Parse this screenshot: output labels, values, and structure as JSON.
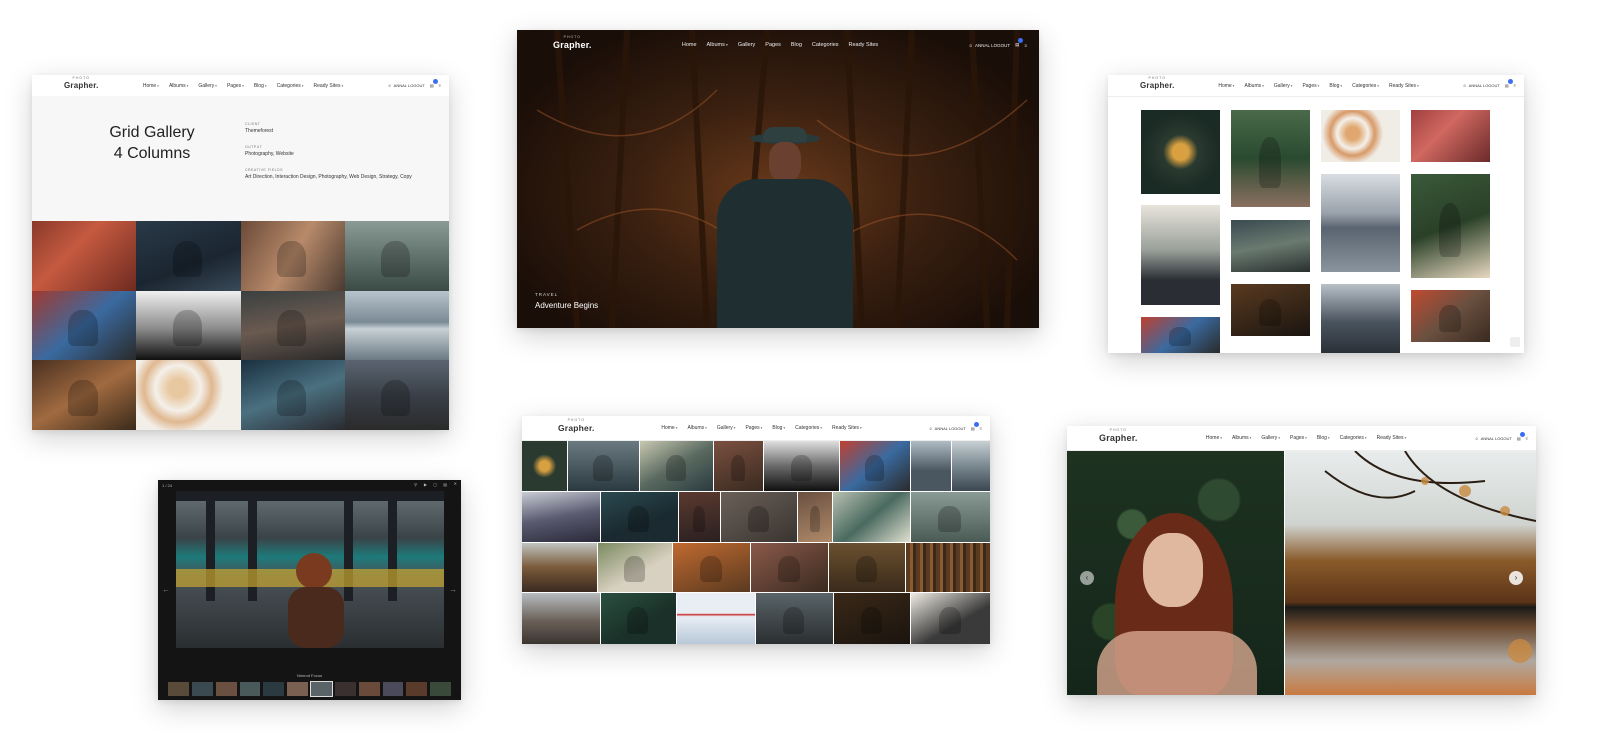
{
  "brand": {
    "logo": "Grapher.",
    "tagline": "PHOTO"
  },
  "nav": {
    "items": [
      "Home",
      "Albums",
      "Gallery",
      "Pages",
      "Blog",
      "Categories",
      "Ready Sites"
    ],
    "user": "ANNAL LOGOUT"
  },
  "gallery_page": {
    "title_line1": "Grid Gallery",
    "title_line2": "4 Columns",
    "client_label": "CLIENT",
    "client_value": "Themeforest",
    "output_label": "OUTPUT",
    "output_value": "Photography, Website",
    "fields_label": "CREATIVE FIELDS",
    "fields_value": "Art Direction, Interaction Design, Photography, Web Design, Strategy, Copy"
  },
  "hero": {
    "category": "TRAVEL",
    "title": "Adventure Begins"
  },
  "lightbox": {
    "counter": "1 / 24",
    "caption": "Nimrod Focus"
  },
  "colors": {
    "accent": "#3b6ef6",
    "dark": "#141414"
  }
}
